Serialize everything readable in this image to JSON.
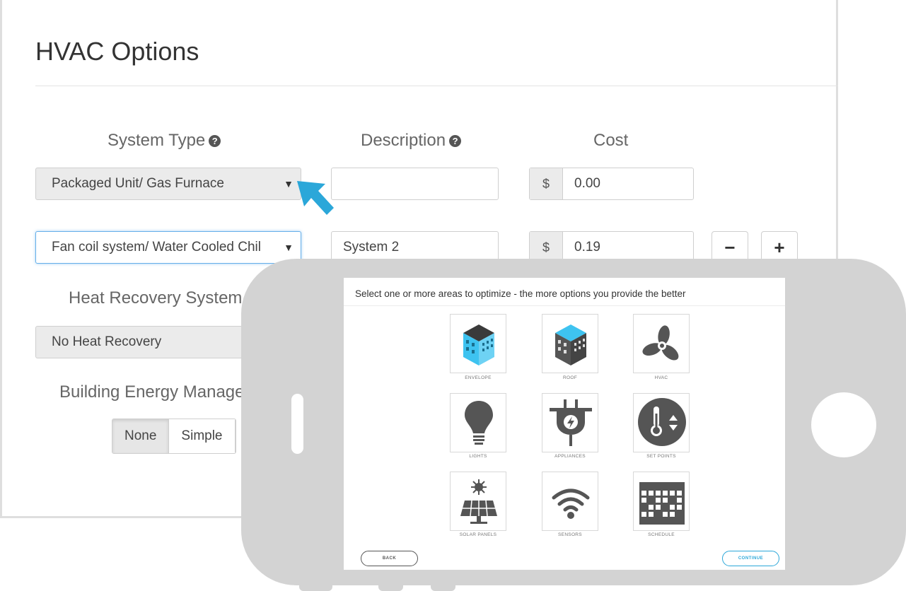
{
  "form": {
    "title": "HVAC Options",
    "headers": {
      "system_type": "System Type",
      "description": "Description",
      "cost": "Cost",
      "heat_recovery": "Heat Recovery System",
      "bems": "Building Energy Management"
    },
    "rows": [
      {
        "system_type": "Packaged Unit/ Gas Furnace",
        "description": "",
        "currency": "$",
        "cost": "0.00"
      },
      {
        "system_type": "Fan coil system/ Water Cooled Chil",
        "description": "System 2",
        "currency": "$",
        "cost": "0.19"
      }
    ],
    "remove_label": "−",
    "add_label": "+",
    "heat_recovery_value": "No Heat Recovery",
    "bems_options": [
      "None",
      "Simple"
    ],
    "bems_selected": "None",
    "help_glyph": "?",
    "caret_glyph": "▼"
  },
  "phone": {
    "heading": "Select one or more areas to optimize - the more options you provide the better",
    "tiles": [
      {
        "label": "ENVELOPE",
        "icon": "building-blue-icon"
      },
      {
        "label": "ROOF",
        "icon": "building-roof-icon"
      },
      {
        "label": "HVAC",
        "icon": "fan-icon"
      },
      {
        "label": "LIGHTS",
        "icon": "lightbulb-icon"
      },
      {
        "label": "APPLIANCES",
        "icon": "plug-icon"
      },
      {
        "label": "SET POINTS",
        "icon": "thermostat-icon"
      },
      {
        "label": "SOLAR PANELS",
        "icon": "solar-panel-icon"
      },
      {
        "label": "SENSORS",
        "icon": "wifi-icon"
      },
      {
        "label": "SCHEDULE",
        "icon": "calendar-grid-icon"
      }
    ],
    "back_label": "BACK",
    "continue_label": "CONTINUE"
  },
  "colors": {
    "accent_blue": "#2ba7d9",
    "icon_blue": "#3ec3f0",
    "icon_gray": "#555555",
    "phone_body": "#d3d3d3"
  }
}
